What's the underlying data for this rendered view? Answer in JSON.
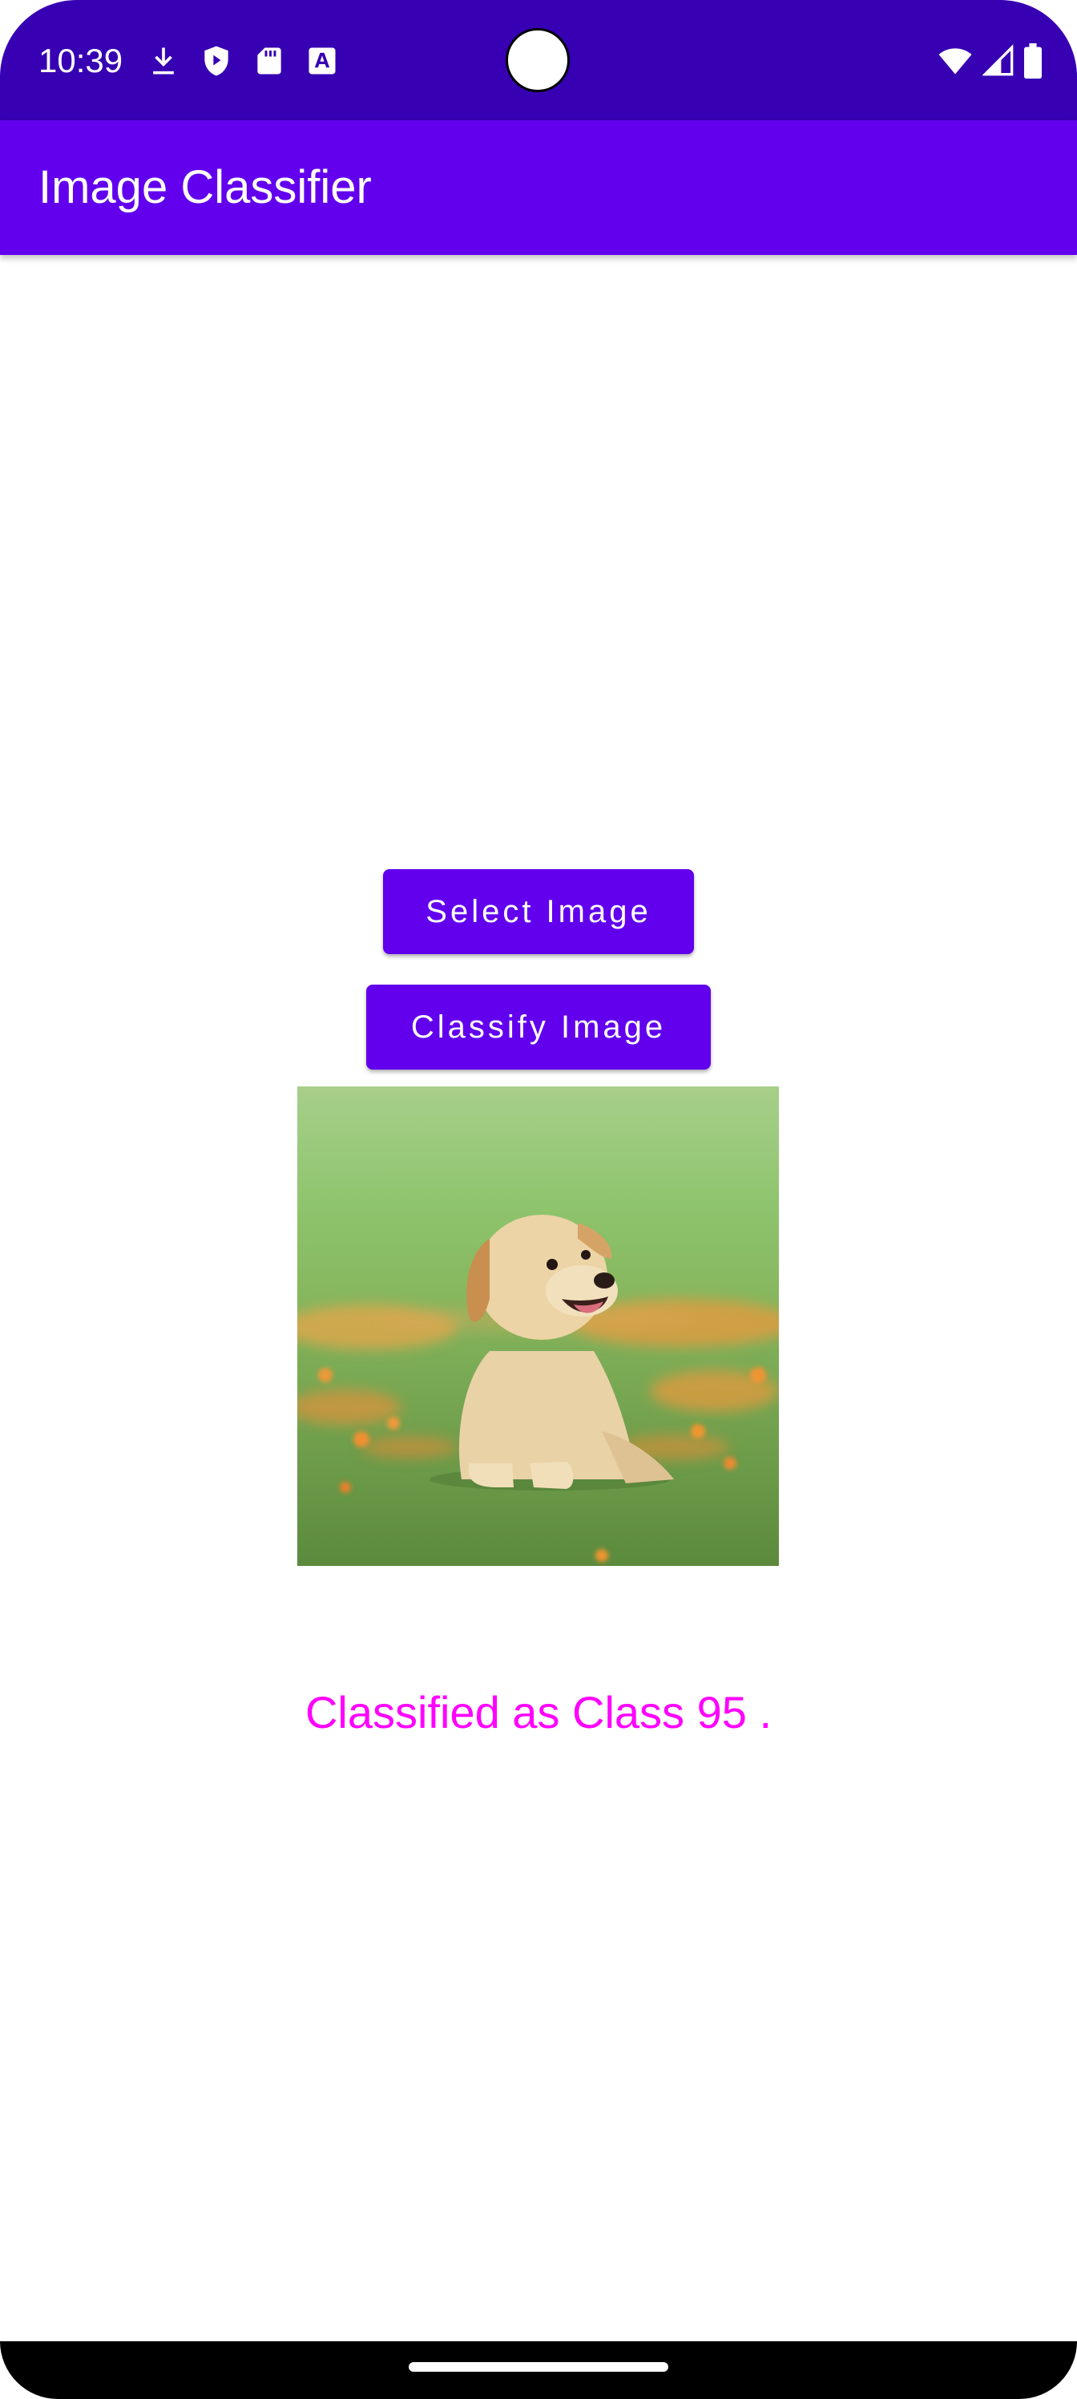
{
  "status_bar": {
    "time": "10:39",
    "left_icons": [
      "download-icon",
      "shield-play-icon",
      "sd-card-icon",
      "font-a-icon"
    ],
    "right_icons": [
      "wifi-icon",
      "cell-signal-icon",
      "battery-icon"
    ],
    "color": "#3700b3"
  },
  "app_bar": {
    "title": "Image Classifier",
    "color": "#6200ee"
  },
  "main": {
    "select_button_label": "Select Image",
    "classify_button_label": "Classify Image",
    "result_text": "Classified as Class 95 .",
    "result_color": "#ff00ff"
  }
}
